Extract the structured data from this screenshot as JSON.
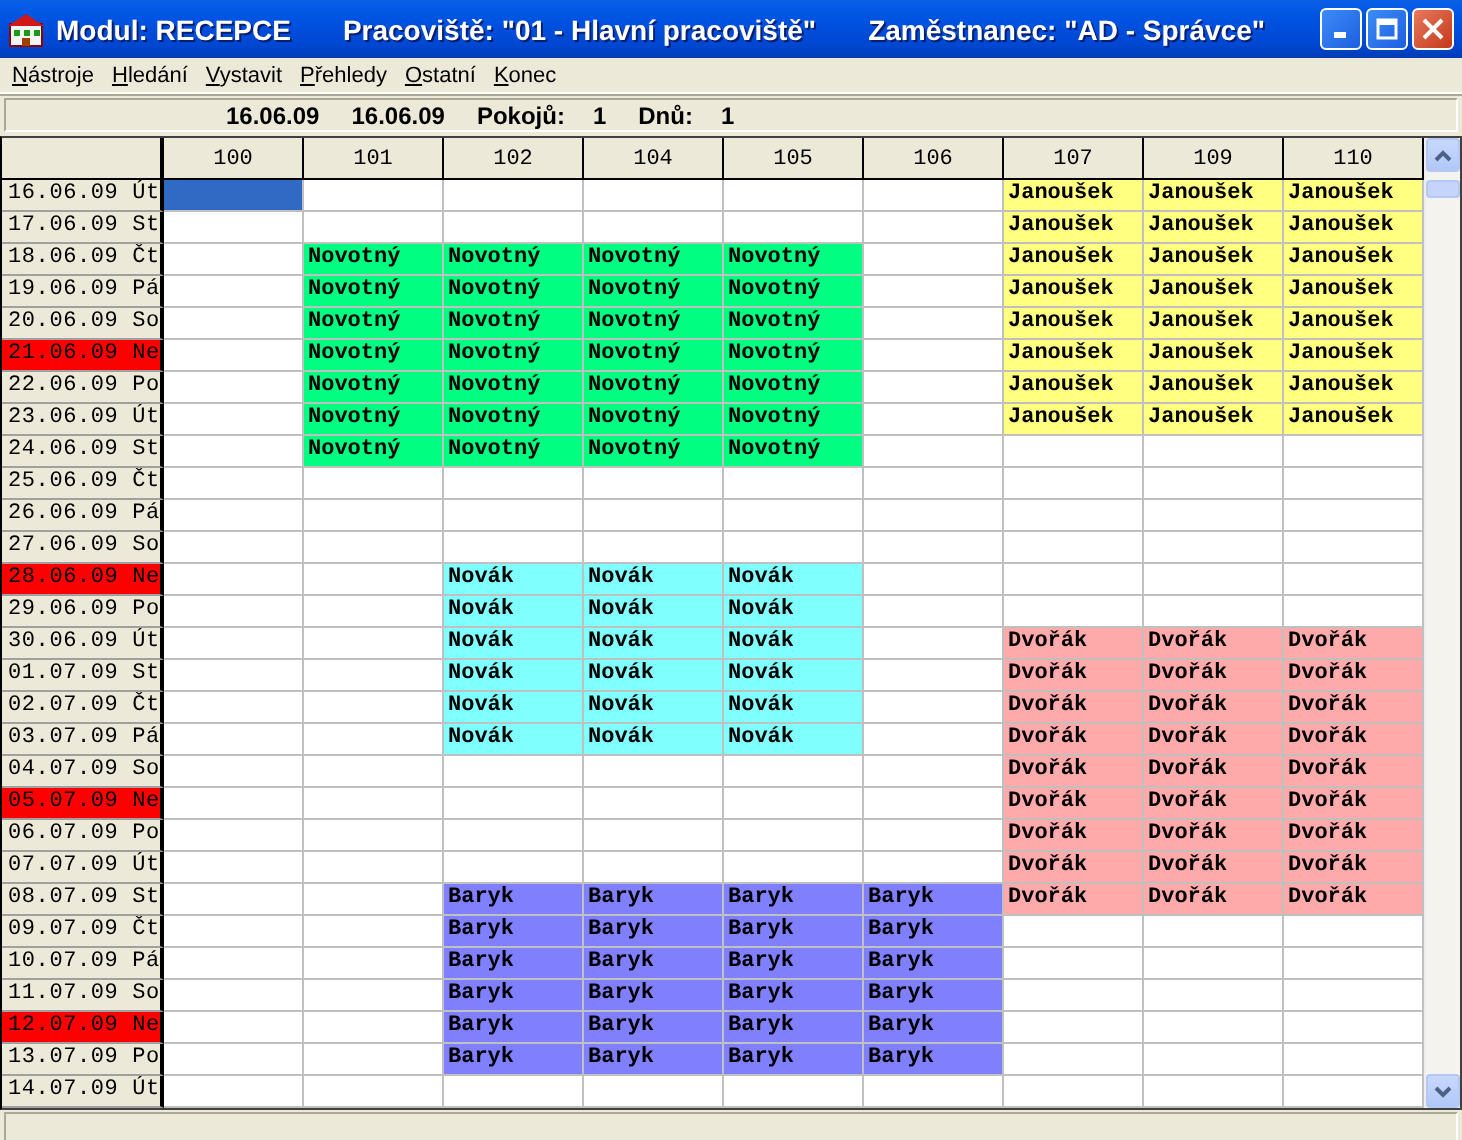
{
  "window": {
    "title_parts": [
      "Modul: RECEPCE",
      "Pracoviště: \"01 - Hlavní pracoviště\"",
      "Zaměstnanec: \"AD - Správce\""
    ]
  },
  "menu": [
    "Nástroje",
    "Hledání",
    "Vystavit",
    "Přehledy",
    "Ostatní",
    "Konec"
  ],
  "info_bar": {
    "date_from": "16.06.09",
    "date_to": "16.06.09",
    "rooms_label": "Pokojů:",
    "rooms": "1",
    "days_label": "Dnů:",
    "days": "1"
  },
  "grid": {
    "columns": [
      "100",
      "101",
      "102",
      "104",
      "105",
      "106",
      "107",
      "109",
      "110"
    ],
    "rows": [
      {
        "date": "16.06.09 Út",
        "holiday": false,
        "cells": [
          {
            "selected": true
          },
          null,
          null,
          null,
          null,
          null,
          {
            "guest": "Janoušek",
            "color": "#ffff80"
          },
          {
            "guest": "Janoušek",
            "color": "#ffff80"
          },
          {
            "guest": "Janoušek",
            "color": "#ffff80"
          }
        ]
      },
      {
        "date": "17.06.09 St",
        "holiday": false,
        "cells": [
          null,
          null,
          null,
          null,
          null,
          null,
          {
            "guest": "Janoušek",
            "color": "#ffff80"
          },
          {
            "guest": "Janoušek",
            "color": "#ffff80"
          },
          {
            "guest": "Janoušek",
            "color": "#ffff80"
          }
        ]
      },
      {
        "date": "18.06.09 Čt",
        "holiday": false,
        "cells": [
          null,
          {
            "guest": "Novotný",
            "color": "#00ff80"
          },
          {
            "guest": "Novotný",
            "color": "#00ff80"
          },
          {
            "guest": "Novotný",
            "color": "#00ff80"
          },
          {
            "guest": "Novotný",
            "color": "#00ff80"
          },
          null,
          {
            "guest": "Janoušek",
            "color": "#ffff80"
          },
          {
            "guest": "Janoušek",
            "color": "#ffff80"
          },
          {
            "guest": "Janoušek",
            "color": "#ffff80"
          }
        ]
      },
      {
        "date": "19.06.09 Pá",
        "holiday": false,
        "cells": [
          null,
          {
            "guest": "Novotný",
            "color": "#00ff80"
          },
          {
            "guest": "Novotný",
            "color": "#00ff80"
          },
          {
            "guest": "Novotný",
            "color": "#00ff80"
          },
          {
            "guest": "Novotný",
            "color": "#00ff80"
          },
          null,
          {
            "guest": "Janoušek",
            "color": "#ffff80"
          },
          {
            "guest": "Janoušek",
            "color": "#ffff80"
          },
          {
            "guest": "Janoušek",
            "color": "#ffff80"
          }
        ]
      },
      {
        "date": "20.06.09 So",
        "holiday": false,
        "cells": [
          null,
          {
            "guest": "Novotný",
            "color": "#00ff80"
          },
          {
            "guest": "Novotný",
            "color": "#00ff80"
          },
          {
            "guest": "Novotný",
            "color": "#00ff80"
          },
          {
            "guest": "Novotný",
            "color": "#00ff80"
          },
          null,
          {
            "guest": "Janoušek",
            "color": "#ffff80"
          },
          {
            "guest": "Janoušek",
            "color": "#ffff80"
          },
          {
            "guest": "Janoušek",
            "color": "#ffff80"
          }
        ]
      },
      {
        "date": "21.06.09 Ne",
        "holiday": true,
        "cells": [
          null,
          {
            "guest": "Novotný",
            "color": "#00ff80"
          },
          {
            "guest": "Novotný",
            "color": "#00ff80"
          },
          {
            "guest": "Novotný",
            "color": "#00ff80"
          },
          {
            "guest": "Novotný",
            "color": "#00ff80"
          },
          null,
          {
            "guest": "Janoušek",
            "color": "#ffff80"
          },
          {
            "guest": "Janoušek",
            "color": "#ffff80"
          },
          {
            "guest": "Janoušek",
            "color": "#ffff80"
          }
        ]
      },
      {
        "date": "22.06.09 Po",
        "holiday": false,
        "cells": [
          null,
          {
            "guest": "Novotný",
            "color": "#00ff80"
          },
          {
            "guest": "Novotný",
            "color": "#00ff80"
          },
          {
            "guest": "Novotný",
            "color": "#00ff80"
          },
          {
            "guest": "Novotný",
            "color": "#00ff80"
          },
          null,
          {
            "guest": "Janoušek",
            "color": "#ffff80"
          },
          {
            "guest": "Janoušek",
            "color": "#ffff80"
          },
          {
            "guest": "Janoušek",
            "color": "#ffff80"
          }
        ]
      },
      {
        "date": "23.06.09 Út",
        "holiday": false,
        "cells": [
          null,
          {
            "guest": "Novotný",
            "color": "#00ff80"
          },
          {
            "guest": "Novotný",
            "color": "#00ff80"
          },
          {
            "guest": "Novotný",
            "color": "#00ff80"
          },
          {
            "guest": "Novotný",
            "color": "#00ff80"
          },
          null,
          {
            "guest": "Janoušek",
            "color": "#ffff80"
          },
          {
            "guest": "Janoušek",
            "color": "#ffff80"
          },
          {
            "guest": "Janoušek",
            "color": "#ffff80"
          }
        ]
      },
      {
        "date": "24.06.09 St",
        "holiday": false,
        "cells": [
          null,
          {
            "guest": "Novotný",
            "color": "#00ff80"
          },
          {
            "guest": "Novotný",
            "color": "#00ff80"
          },
          {
            "guest": "Novotný",
            "color": "#00ff80"
          },
          {
            "guest": "Novotný",
            "color": "#00ff80"
          },
          null,
          null,
          null,
          null
        ]
      },
      {
        "date": "25.06.09 Čt",
        "holiday": false,
        "cells": [
          null,
          null,
          null,
          null,
          null,
          null,
          null,
          null,
          null
        ]
      },
      {
        "date": "26.06.09 Pá",
        "holiday": false,
        "cells": [
          null,
          null,
          null,
          null,
          null,
          null,
          null,
          null,
          null
        ]
      },
      {
        "date": "27.06.09 So",
        "holiday": false,
        "cells": [
          null,
          null,
          null,
          null,
          null,
          null,
          null,
          null,
          null
        ]
      },
      {
        "date": "28.06.09 Ne",
        "holiday": true,
        "cells": [
          null,
          null,
          {
            "guest": "Novák",
            "color": "#80ffff"
          },
          {
            "guest": "Novák",
            "color": "#80ffff"
          },
          {
            "guest": "Novák",
            "color": "#80ffff"
          },
          null,
          null,
          null,
          null
        ]
      },
      {
        "date": "29.06.09 Po",
        "holiday": false,
        "cells": [
          null,
          null,
          {
            "guest": "Novák",
            "color": "#80ffff"
          },
          {
            "guest": "Novák",
            "color": "#80ffff"
          },
          {
            "guest": "Novák",
            "color": "#80ffff"
          },
          null,
          null,
          null,
          null
        ]
      },
      {
        "date": "30.06.09 Út",
        "holiday": false,
        "cells": [
          null,
          null,
          {
            "guest": "Novák",
            "color": "#80ffff"
          },
          {
            "guest": "Novák",
            "color": "#80ffff"
          },
          {
            "guest": "Novák",
            "color": "#80ffff"
          },
          null,
          {
            "guest": "Dvořák",
            "color": "#ffaaaa"
          },
          {
            "guest": "Dvořák",
            "color": "#ffaaaa"
          },
          {
            "guest": "Dvořák",
            "color": "#ffaaaa"
          }
        ]
      },
      {
        "date": "01.07.09 St",
        "holiday": false,
        "cells": [
          null,
          null,
          {
            "guest": "Novák",
            "color": "#80ffff"
          },
          {
            "guest": "Novák",
            "color": "#80ffff"
          },
          {
            "guest": "Novák",
            "color": "#80ffff"
          },
          null,
          {
            "guest": "Dvořák",
            "color": "#ffaaaa"
          },
          {
            "guest": "Dvořák",
            "color": "#ffaaaa"
          },
          {
            "guest": "Dvořák",
            "color": "#ffaaaa"
          }
        ]
      },
      {
        "date": "02.07.09 Čt",
        "holiday": false,
        "cells": [
          null,
          null,
          {
            "guest": "Novák",
            "color": "#80ffff"
          },
          {
            "guest": "Novák",
            "color": "#80ffff"
          },
          {
            "guest": "Novák",
            "color": "#80ffff"
          },
          null,
          {
            "guest": "Dvořák",
            "color": "#ffaaaa"
          },
          {
            "guest": "Dvořák",
            "color": "#ffaaaa"
          },
          {
            "guest": "Dvořák",
            "color": "#ffaaaa"
          }
        ]
      },
      {
        "date": "03.07.09 Pá",
        "holiday": false,
        "cells": [
          null,
          null,
          {
            "guest": "Novák",
            "color": "#80ffff"
          },
          {
            "guest": "Novák",
            "color": "#80ffff"
          },
          {
            "guest": "Novák",
            "color": "#80ffff"
          },
          null,
          {
            "guest": "Dvořák",
            "color": "#ffaaaa"
          },
          {
            "guest": "Dvořák",
            "color": "#ffaaaa"
          },
          {
            "guest": "Dvořák",
            "color": "#ffaaaa"
          }
        ]
      },
      {
        "date": "04.07.09 So",
        "holiday": false,
        "cells": [
          null,
          null,
          null,
          null,
          null,
          null,
          {
            "guest": "Dvořák",
            "color": "#ffaaaa"
          },
          {
            "guest": "Dvořák",
            "color": "#ffaaaa"
          },
          {
            "guest": "Dvořák",
            "color": "#ffaaaa"
          }
        ]
      },
      {
        "date": "05.07.09 Ne",
        "holiday": true,
        "cells": [
          null,
          null,
          null,
          null,
          null,
          null,
          {
            "guest": "Dvořák",
            "color": "#ffaaaa"
          },
          {
            "guest": "Dvořák",
            "color": "#ffaaaa"
          },
          {
            "guest": "Dvořák",
            "color": "#ffaaaa"
          }
        ]
      },
      {
        "date": "06.07.09 Po",
        "holiday": false,
        "cells": [
          null,
          null,
          null,
          null,
          null,
          null,
          {
            "guest": "Dvořák",
            "color": "#ffaaaa"
          },
          {
            "guest": "Dvořák",
            "color": "#ffaaaa"
          },
          {
            "guest": "Dvořák",
            "color": "#ffaaaa"
          }
        ]
      },
      {
        "date": "07.07.09 Út",
        "holiday": false,
        "cells": [
          null,
          null,
          null,
          null,
          null,
          null,
          {
            "guest": "Dvořák",
            "color": "#ffaaaa"
          },
          {
            "guest": "Dvořák",
            "color": "#ffaaaa"
          },
          {
            "guest": "Dvořák",
            "color": "#ffaaaa"
          }
        ]
      },
      {
        "date": "08.07.09 St",
        "holiday": false,
        "cells": [
          null,
          null,
          {
            "guest": "Baryk",
            "color": "#8080ff"
          },
          {
            "guest": "Baryk",
            "color": "#8080ff"
          },
          {
            "guest": "Baryk",
            "color": "#8080ff"
          },
          {
            "guest": "Baryk",
            "color": "#8080ff"
          },
          {
            "guest": "Dvořák",
            "color": "#ffaaaa"
          },
          {
            "guest": "Dvořák",
            "color": "#ffaaaa"
          },
          {
            "guest": "Dvořák",
            "color": "#ffaaaa"
          }
        ]
      },
      {
        "date": "09.07.09 Čt",
        "holiday": false,
        "cells": [
          null,
          null,
          {
            "guest": "Baryk",
            "color": "#8080ff"
          },
          {
            "guest": "Baryk",
            "color": "#8080ff"
          },
          {
            "guest": "Baryk",
            "color": "#8080ff"
          },
          {
            "guest": "Baryk",
            "color": "#8080ff"
          },
          null,
          null,
          null
        ]
      },
      {
        "date": "10.07.09 Pá",
        "holiday": false,
        "cells": [
          null,
          null,
          {
            "guest": "Baryk",
            "color": "#8080ff"
          },
          {
            "guest": "Baryk",
            "color": "#8080ff"
          },
          {
            "guest": "Baryk",
            "color": "#8080ff"
          },
          {
            "guest": "Baryk",
            "color": "#8080ff"
          },
          null,
          null,
          null
        ]
      },
      {
        "date": "11.07.09 So",
        "holiday": false,
        "cells": [
          null,
          null,
          {
            "guest": "Baryk",
            "color": "#8080ff"
          },
          {
            "guest": "Baryk",
            "color": "#8080ff"
          },
          {
            "guest": "Baryk",
            "color": "#8080ff"
          },
          {
            "guest": "Baryk",
            "color": "#8080ff"
          },
          null,
          null,
          null
        ]
      },
      {
        "date": "12.07.09 Ne",
        "holiday": true,
        "cells": [
          null,
          null,
          {
            "guest": "Baryk",
            "color": "#8080ff"
          },
          {
            "guest": "Baryk",
            "color": "#8080ff"
          },
          {
            "guest": "Baryk",
            "color": "#8080ff"
          },
          {
            "guest": "Baryk",
            "color": "#8080ff"
          },
          null,
          null,
          null
        ]
      },
      {
        "date": "13.07.09 Po",
        "holiday": false,
        "cells": [
          null,
          null,
          {
            "guest": "Baryk",
            "color": "#8080ff"
          },
          {
            "guest": "Baryk",
            "color": "#8080ff"
          },
          {
            "guest": "Baryk",
            "color": "#8080ff"
          },
          {
            "guest": "Baryk",
            "color": "#8080ff"
          },
          null,
          null,
          null
        ]
      },
      {
        "date": "14.07.09 Út",
        "holiday": false,
        "cells": [
          null,
          null,
          null,
          null,
          null,
          null,
          null,
          null,
          null
        ]
      }
    ]
  }
}
